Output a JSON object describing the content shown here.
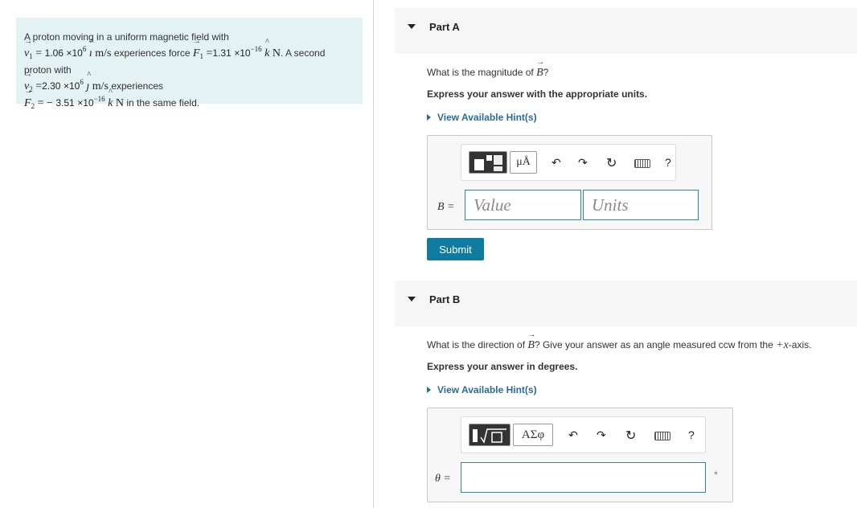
{
  "problem": {
    "intro": "A proton moving in a uniform magnetic field with",
    "v1_label": "v",
    "v1_sub": "1",
    "v1_value": "1.06",
    "v1_exp": "6",
    "v1_unit_vec": "ı",
    "v1_units": "m/s",
    "experiences_force": "experiences force",
    "F1_label": "F",
    "F1_sub": "1",
    "F1_value": "1.31",
    "F1_exp": "−16",
    "F1_unit_vec": "k",
    "F1_units": "N",
    "second_proton": ". A second proton with",
    "v2_label": "v",
    "v2_sub": "2",
    "v2_value": "2.30",
    "v2_exp": "6",
    "v2_unit_vec": "ȷ",
    "v2_units": "m/s",
    "experiences": "experiences",
    "F2_label": "F",
    "F2_sub": "2",
    "F2_value": "3.51",
    "F2_exp": "−16",
    "F2_unit_vec": "k",
    "F2_units": "N",
    "in_field": "in the same field.",
    "times_ten": "×10",
    "equals": "=",
    "minus": "−"
  },
  "partA": {
    "label": "Part A",
    "question": "What is the magnitude of",
    "vec": "B",
    "q_end": "?",
    "instruction": "Express your answer with the appropriate units.",
    "hint": "View Available Hint(s)",
    "field_label": "B =",
    "value_placeholder": "Value",
    "units_placeholder": "Units",
    "units_button": "μÅ",
    "help": "?",
    "submit": "Submit"
  },
  "partB": {
    "label": "Part B",
    "question": "What is the direction of",
    "vec": "B",
    "q_rest": "? Give your answer as an angle measured ccw from the",
    "axis": "+x",
    "q_end": "-axis.",
    "instruction": "Express your answer in degrees.",
    "hint": "View Available Hint(s)",
    "symbols_button": "ΑΣφ",
    "help": "?",
    "field_label": "θ =",
    "degree": "°"
  }
}
